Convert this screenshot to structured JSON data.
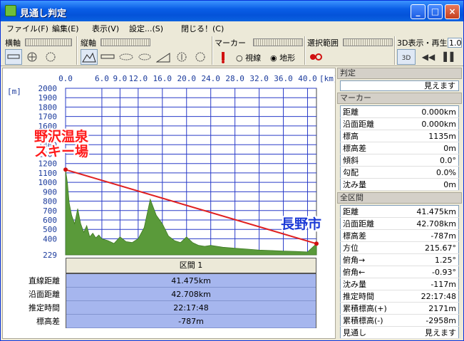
{
  "window": {
    "title": "見通し判定",
    "min": "_",
    "max": "□",
    "close": "×"
  },
  "menu": {
    "file": "ファイル(F)",
    "edit": "編集(E)",
    "view": "表示(V)",
    "settings": "設定...(S)",
    "close": "閉じる！(C)"
  },
  "toolbar": {
    "horizontal_axis": "横軸",
    "vertical_axis": "縦軸",
    "marker": "マーカー",
    "selection": "選択範囲",
    "replay3d": "3D表示・再生",
    "replay_value": "1.0",
    "radio_sight": "視線",
    "radio_terrain": "地形",
    "tool_3d": "3D"
  },
  "graph": {
    "x_unit": "[km]",
    "y_unit": "[m]",
    "x_ticks": [
      "0.0",
      "6.0",
      "9.0",
      "12.0",
      "16.0",
      "20.0",
      "24.0",
      "28.0",
      "32.0",
      "36.0",
      "40.0"
    ],
    "y_ticks": [
      "2000",
      "1900",
      "1800",
      "1700",
      "1600",
      "1500",
      "1400",
      "1300",
      "1200",
      "1100",
      "1000",
      "900",
      "800",
      "700",
      "600",
      "500",
      "400"
    ],
    "y_min_label": "229",
    "label_start": "野沢温泉\nスキー場",
    "label_start_line1": "野沢温泉",
    "label_start_line2": "スキー場",
    "label_end": "長野市",
    "colors": {
      "terrain": "#5a9a3a",
      "sightline": "#e02020",
      "grid": "#2a3cc8"
    }
  },
  "chart_data": {
    "type": "area",
    "xlabel": "[km]",
    "ylabel": "[m]",
    "xlim": [
      0,
      41.475
    ],
    "ylim": [
      229,
      2000
    ],
    "x": [
      0,
      0.3,
      0.6,
      1,
      1.5,
      2,
      2.5,
      3,
      3.5,
      4,
      4.5,
      5,
      5.5,
      6,
      7,
      8,
      9,
      10,
      11,
      12,
      13,
      14,
      15,
      16,
      17,
      18,
      19,
      20,
      21,
      22,
      23,
      24,
      26,
      28,
      30,
      32,
      34,
      36,
      38,
      40,
      41.475
    ],
    "series": [
      {
        "values": [
          1135,
          1000,
          780,
          650,
          560,
          720,
          560,
          470,
          540,
          420,
          460,
          410,
          440,
          400,
          380,
          350,
          420,
          370,
          360,
          400,
          520,
          820,
          650,
          560,
          430,
          380,
          360,
          420,
          360,
          330,
          320,
          330,
          310,
          300,
          290,
          280,
          275,
          270,
          265,
          260,
          348
        ]
      }
    ],
    "sightline": {
      "from": [
        0,
        1135
      ],
      "to": [
        41.475,
        348
      ]
    }
  },
  "section": {
    "label": "区間 1"
  },
  "summary": {
    "labels": [
      "直線距離",
      "沿面距離",
      "推定時間",
      "標高差"
    ],
    "values": [
      "41.475km",
      "42.708km",
      "22:17:48",
      "-787m"
    ]
  },
  "judgement": {
    "header": "判定",
    "value": "見えます"
  },
  "marker_panel": {
    "header": "マーカー",
    "rows": [
      {
        "k": "距離",
        "v": "0.000km"
      },
      {
        "k": "沿面距離",
        "v": "0.000km"
      },
      {
        "k": "標高",
        "v": "1135m"
      },
      {
        "k": "標高差",
        "v": "0m"
      },
      {
        "k": "傾斜",
        "v": "0.0°"
      },
      {
        "k": "勾配",
        "v": "0.0%"
      },
      {
        "k": "沈み量",
        "v": "0m"
      }
    ]
  },
  "all_panel": {
    "header": "全区間",
    "rows": [
      {
        "k": "距離",
        "v": "41.475km"
      },
      {
        "k": "沿面距離",
        "v": "42.708km"
      },
      {
        "k": "標高差",
        "v": "-787m"
      },
      {
        "k": "方位",
        "v": "215.67°"
      },
      {
        "k": "俯角→",
        "v": "1.25°"
      },
      {
        "k": "俯角←",
        "v": "-0.93°"
      },
      {
        "k": "沈み量",
        "v": "-117m"
      },
      {
        "k": "推定時間",
        "v": "22:17:48"
      },
      {
        "k": "累積標高(+)",
        "v": "2171m"
      },
      {
        "k": "累積標高(-)",
        "v": "-2958m"
      },
      {
        "k": "見通し",
        "v": "見えます"
      }
    ]
  }
}
